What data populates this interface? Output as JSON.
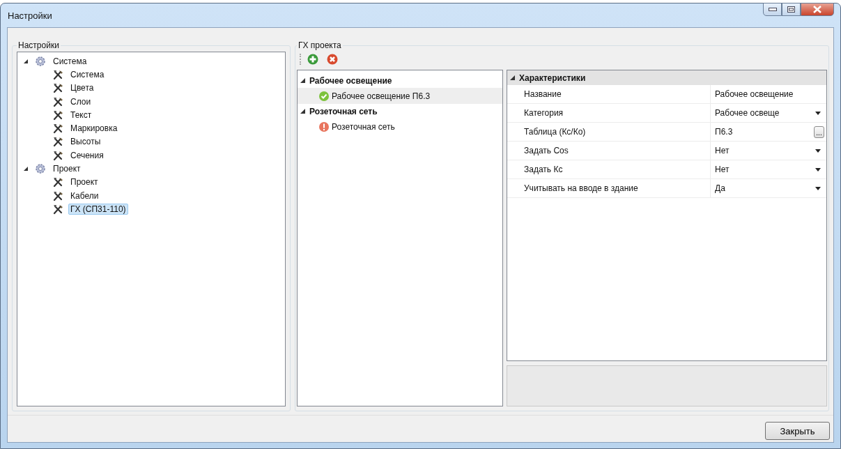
{
  "window": {
    "title": "Настройки"
  },
  "settings_panel": {
    "legend": "Настройки",
    "tree": [
      {
        "label": "Система",
        "kind": "group",
        "expanded": true,
        "selected": false,
        "children": [
          {
            "label": "Система",
            "kind": "item",
            "selected": false
          },
          {
            "label": "Цвета",
            "kind": "item",
            "selected": false
          },
          {
            "label": "Слои",
            "kind": "item",
            "selected": false
          },
          {
            "label": "Текст",
            "kind": "item",
            "selected": false
          },
          {
            "label": "Маркировка",
            "kind": "item",
            "selected": false
          },
          {
            "label": "Высоты",
            "kind": "item",
            "selected": false
          },
          {
            "label": "Сечения",
            "kind": "item",
            "selected": false
          }
        ]
      },
      {
        "label": "Проект",
        "kind": "group",
        "expanded": true,
        "selected": false,
        "children": [
          {
            "label": "Проект",
            "kind": "item",
            "selected": false
          },
          {
            "label": "Кабели",
            "kind": "item",
            "selected": false
          },
          {
            "label": "ГХ (СП31-110)",
            "kind": "item",
            "selected": true
          }
        ]
      }
    ]
  },
  "project_panel": {
    "legend": "ГХ проекта",
    "groups": [
      {
        "label": "Рабочее освещение",
        "expanded": true,
        "children": [
          {
            "label": "Рабочее освещение П6.3",
            "kind": "ok",
            "selected": true
          }
        ]
      },
      {
        "label": "Розеточная сеть",
        "expanded": true,
        "children": [
          {
            "label": "Розеточная сеть",
            "kind": "error",
            "selected": false
          }
        ]
      }
    ],
    "properties": {
      "category": "Характеристики",
      "expanded": true,
      "rows": [
        {
          "name": "Название",
          "value": "Рабочее освещение",
          "kind": "text"
        },
        {
          "name": "Категория",
          "value": "Рабочее освеще",
          "kind": "dropdown"
        },
        {
          "name": "Таблица (Кс/Ко)",
          "value": "П6.3",
          "kind": "button",
          "button": "..."
        },
        {
          "name": "Задать Cos",
          "value": "Нет",
          "kind": "dropdown"
        },
        {
          "name": "Задать Кс",
          "value": "Нет",
          "kind": "dropdown"
        },
        {
          "name": "Учитывать на вводе в здание",
          "value": "Да",
          "kind": "dropdown"
        }
      ]
    }
  },
  "buttons": [
    "Закрыть"
  ]
}
